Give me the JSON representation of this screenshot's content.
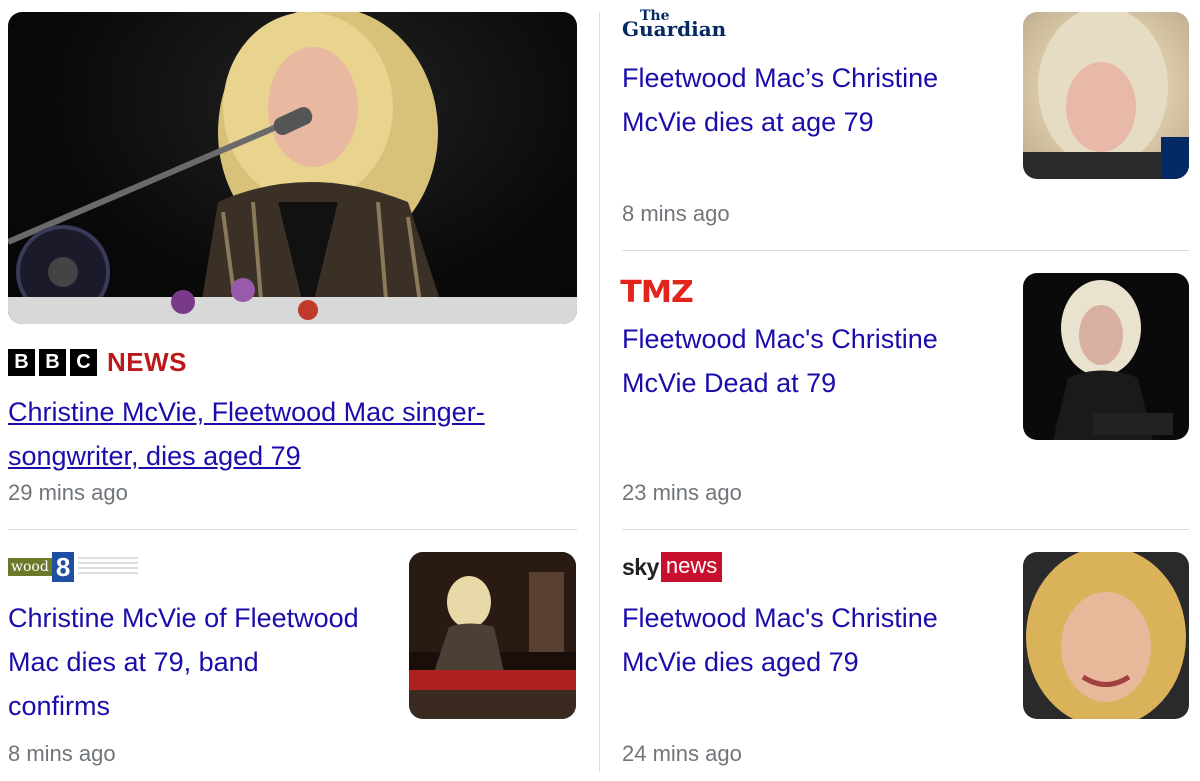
{
  "stories": [
    {
      "source": "BBC NEWS",
      "source_logo": {
        "blocks": [
          "B",
          "B",
          "C"
        ],
        "word": "NEWS"
      },
      "headline_line1": "Christine McVie, Fleetwood Mac singer-",
      "headline_line2": "songwriter, dies aged 79",
      "time": "29 mins ago"
    },
    {
      "source": "The Guardian",
      "source_logo": {
        "the": "The",
        "name": "Guardian"
      },
      "headline_line1": "Fleetwood Mac’s Christine",
      "headline_line2": "McVie dies at age 79",
      "time": "8 mins ago"
    },
    {
      "source": "TMZ",
      "source_logo": {
        "name": "TMZ"
      },
      "headline_line1": "Fleetwood Mac's Christine",
      "headline_line2": "McVie Dead at 79",
      "time": "23 mins ago"
    },
    {
      "source": "WOOD TV8",
      "source_logo": {
        "wood": "wood",
        "num": "8"
      },
      "headline_line1": "Christine McVie of Fleetwood",
      "headline_line2": "Mac dies at 79, band",
      "headline_line3": "confirms",
      "time": "8 mins ago"
    },
    {
      "source": "Sky News",
      "source_logo": {
        "sky": "sky",
        "news": "news"
      },
      "headline_line1": "Fleetwood Mac's Christine",
      "headline_line2": "McVie dies aged 79",
      "time": "24 mins ago"
    }
  ],
  "colors": {
    "link": "#1a0dab",
    "time": "#70757a",
    "bbc_red": "#bb1919",
    "tmz_red": "#e3241b",
    "sky_red": "#c8102e",
    "guardian_blue": "#052962"
  }
}
